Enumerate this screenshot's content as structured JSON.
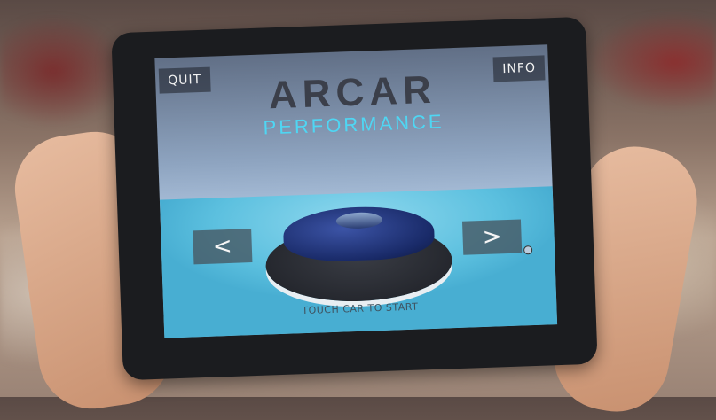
{
  "app": {
    "quit_label": "QUIT",
    "info_label": "INFO",
    "title": "ARCAR",
    "subtitle": "PERFORMANCE",
    "prev_label": "<",
    "next_label": ">",
    "hint": "TOUCH CAR TO START"
  },
  "colors": {
    "accent": "#4fd6f3",
    "title": "#3b3f4a",
    "floor": "#5cc0df"
  },
  "icons": {
    "prev": "chevron-left-icon",
    "next": "chevron-right-icon"
  }
}
